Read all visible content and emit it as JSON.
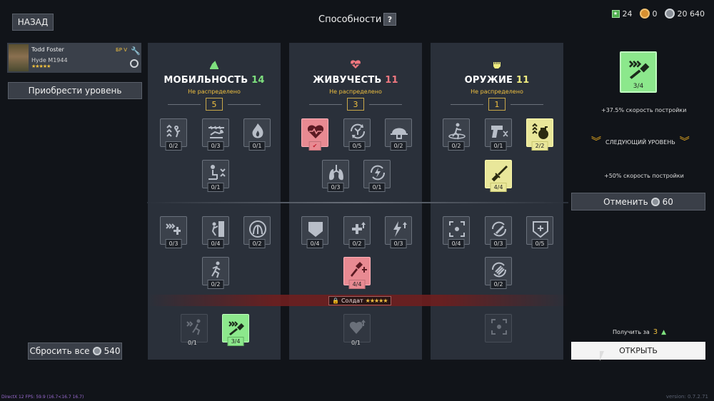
{
  "header": {
    "back_label": "НАЗАД",
    "title": "Способности",
    "help_label": "?",
    "currencies": [
      {
        "icon": "star-badge-icon",
        "value": "24",
        "color": "#4cae4c"
      },
      {
        "icon": "gold-coin-icon",
        "value": "0",
        "color": "#d89030"
      },
      {
        "icon": "silver-coin-icon",
        "value": "20 640",
        "color": "#c0c4c8"
      }
    ]
  },
  "soldier": {
    "name": "Todd Foster",
    "rank": "БР V",
    "weapon": "Hyde M1944",
    "stars": "★★★★★"
  },
  "left": {
    "buy_level_label": "Приобрести уровень",
    "reset_all_label": "Сбросить все",
    "reset_all_cost": "540"
  },
  "columns": [
    {
      "name": "МОБИЛЬНОСТЬ",
      "value": "14",
      "value_color": "#7ee07e",
      "unassigned_label": "Не распределено",
      "points": "5",
      "icon": "mobility-icon",
      "icon_color": "#7ee07e",
      "top_skills": [
        "0/2",
        "0/3",
        "0/1",
        "0/1"
      ],
      "mid_skills": [
        "0/3",
        "0/4",
        "0/2",
        "0/2"
      ],
      "bottom_skills": [
        "0/1",
        "3/4"
      ]
    },
    {
      "name": "ЖИВУЧЕСТЬ",
      "value": "11",
      "value_color": "#f07880",
      "unassigned_label": "Не распределено",
      "points": "3",
      "icon": "heart-pulse-icon",
      "icon_color": "#f07880",
      "top_skills": [
        "",
        "0/5",
        "0/2",
        "0/3",
        "0/1"
      ],
      "mid_skills": [
        "0/4",
        "0/2",
        "0/3",
        "4/4"
      ],
      "bottom_skills": [
        "0/1"
      ]
    },
    {
      "name": "ОРУЖИЕ",
      "value": "11",
      "value_color": "#f0ec80",
      "unassigned_label": "Не распределено",
      "points": "1",
      "icon": "fist-icon",
      "icon_color": "#f0ec80",
      "top_skills": [
        "0/2",
        "0/1",
        "2/2",
        "4/4"
      ],
      "mid_skills": [
        "0/4",
        "0/3",
        "0/5",
        "0/2"
      ],
      "bottom_skills": [
        ""
      ]
    }
  ],
  "lock": {
    "label": "Солдат",
    "stars": "★★★★★"
  },
  "right_panel": {
    "selected_count": "3/4",
    "current_effect": "+37.5% скорость постройки",
    "next_level_label": "СЛЕДУЮЩИЙ УРОВЕНЬ",
    "next_effect": "+50% скорость постройки",
    "cancel_label": "Отменить",
    "cancel_cost": "60",
    "obtain_for_label": "Получить за",
    "obtain_for_value": "3",
    "open_label": "ОТКРЫТЬ"
  },
  "footer": {
    "fps": "DirectX 12 FPS: 59.9 (16.7<16.7 16.7)",
    "version": "version: 0.7.2.71"
  }
}
